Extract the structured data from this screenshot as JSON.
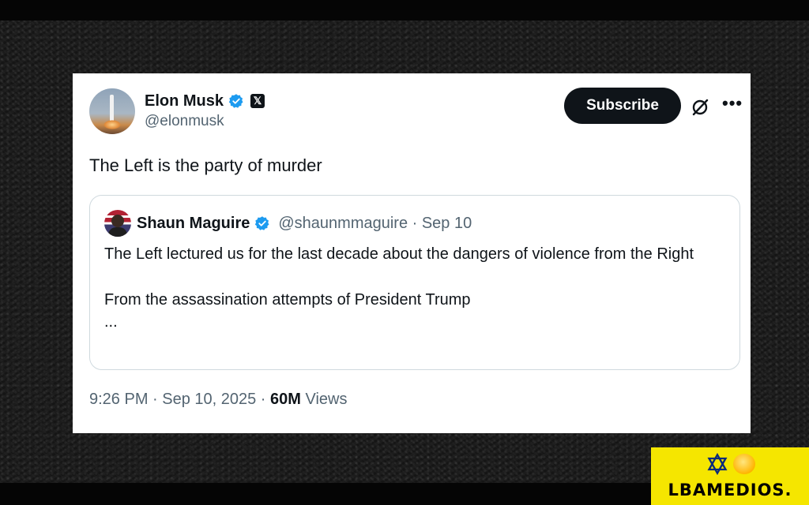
{
  "tweet": {
    "display_name": "Elon Musk",
    "handle": "@elonmusk",
    "subscribe_label": "Subscribe",
    "text": "The Left is the party of murder",
    "timestamp": "9:26 PM · Sep 10, 2025 · ",
    "views_count": "60M",
    "views_label": " Views"
  },
  "quote": {
    "display_name": "Shaun Maguire",
    "handle": "@shaunmmaguire · Sep 10",
    "line1": "The Left lectured us for the last decade about the dangers of violence from the Right",
    "line2": "From the assassination attempts of President Trump",
    "line3": "..."
  },
  "watermark": {
    "text": "LBAMEDIOS."
  },
  "colors": {
    "verified": "#1d9bf0",
    "badge_bg": "#f5e600",
    "text_primary": "#0f1419",
    "text_secondary": "#536471"
  },
  "icons": [
    "verified-badge-icon",
    "x-logo-icon",
    "grok-icon",
    "more-icon",
    "star-of-david-icon"
  ]
}
